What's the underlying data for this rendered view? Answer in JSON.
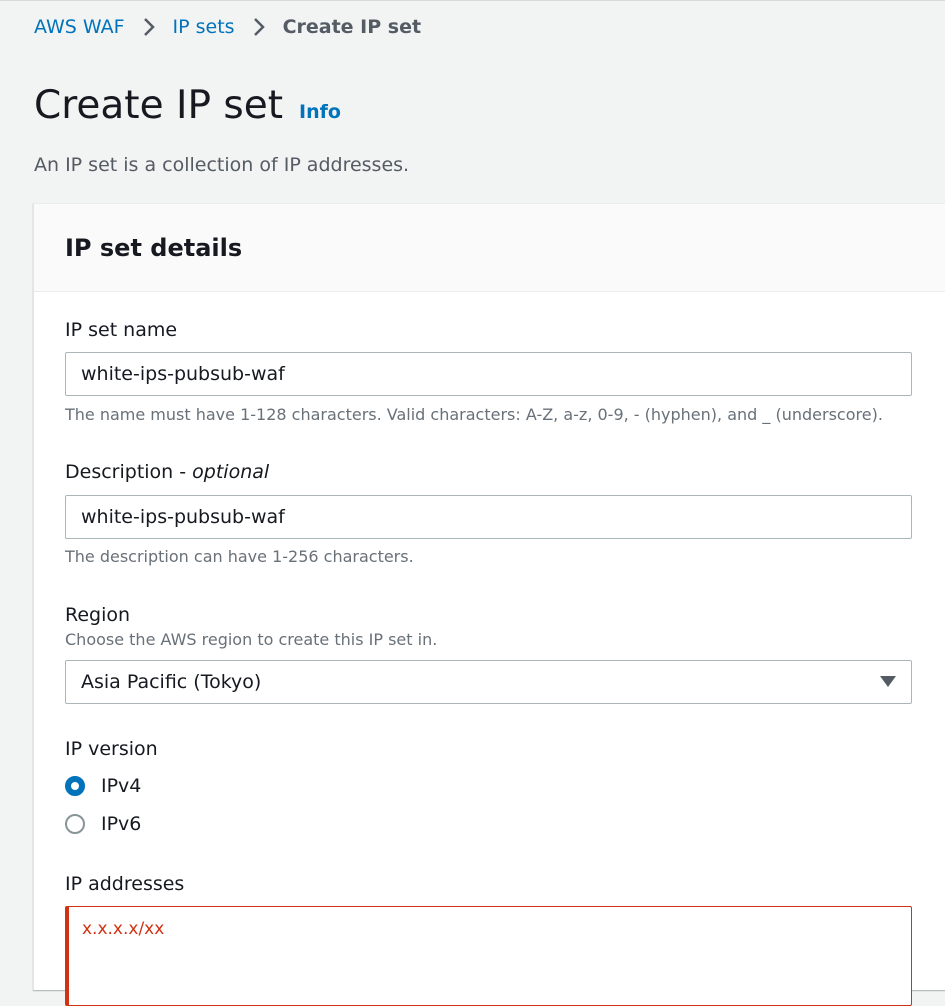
{
  "breadcrumb": {
    "items": [
      "AWS WAF",
      "IP sets"
    ],
    "current": "Create IP set"
  },
  "page": {
    "title": "Create IP set",
    "info_label": "Info",
    "description": "An IP set is a collection of IP addresses."
  },
  "container": {
    "title": "IP set details"
  },
  "form": {
    "name": {
      "label": "IP set name",
      "value": "white-ips-pubsub-waf",
      "hint": "The name must have 1-128 characters. Valid characters: A-Z, a-z, 0-9, - (hyphen), and _ (underscore)."
    },
    "description": {
      "label": "Description - ",
      "label_optional": "optional",
      "value": "white-ips-pubsub-waf",
      "hint": "The description can have 1-256 characters."
    },
    "region": {
      "label": "Region",
      "hint": "Choose the AWS region to create this IP set in.",
      "value": "Asia Pacific (Tokyo)"
    },
    "ip_version": {
      "label": "IP version",
      "options": [
        "IPv4",
        "IPv6"
      ],
      "selected": "IPv4"
    },
    "ip_addresses": {
      "label": "IP addresses",
      "value": "x.x.x.x/xx"
    }
  },
  "colors": {
    "link": "#0073bb",
    "error": "#d13212",
    "background": "#f2f3f3"
  }
}
